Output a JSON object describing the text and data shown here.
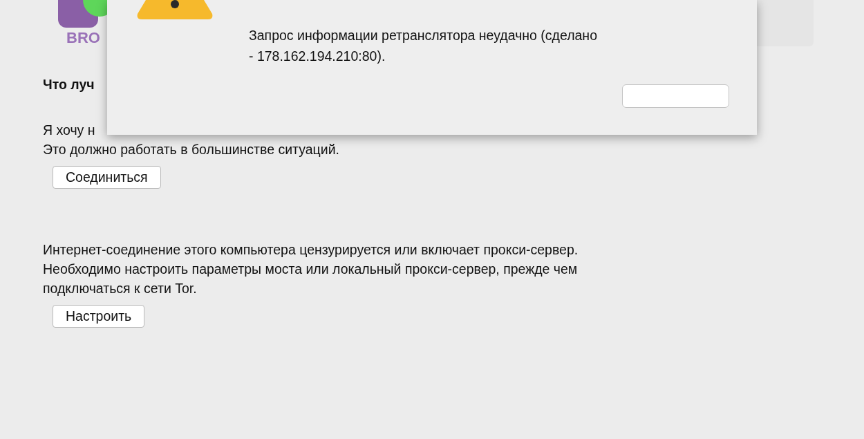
{
  "logo": {
    "text": "BRO"
  },
  "content": {
    "heading": "Что луч",
    "options": [
      {
        "lines": [
          "Я хочу н",
          "Это должно работать в большинстве ситуаций."
        ],
        "button": "Соединиться"
      },
      {
        "lines": [
          "Интернет-соединение этого компьютера цензурируется или включает прокси-сервер.",
          "Необходимо настроить параметры моста или локальный прокси-сервер, прежде чем",
          "подключаться к сети Tor."
        ],
        "button": "Настроить"
      }
    ]
  },
  "dialog": {
    "message": [
      "Запрос информации ретранслятора неудачно (сделано",
      "- 178.162.194.210:80)."
    ]
  }
}
